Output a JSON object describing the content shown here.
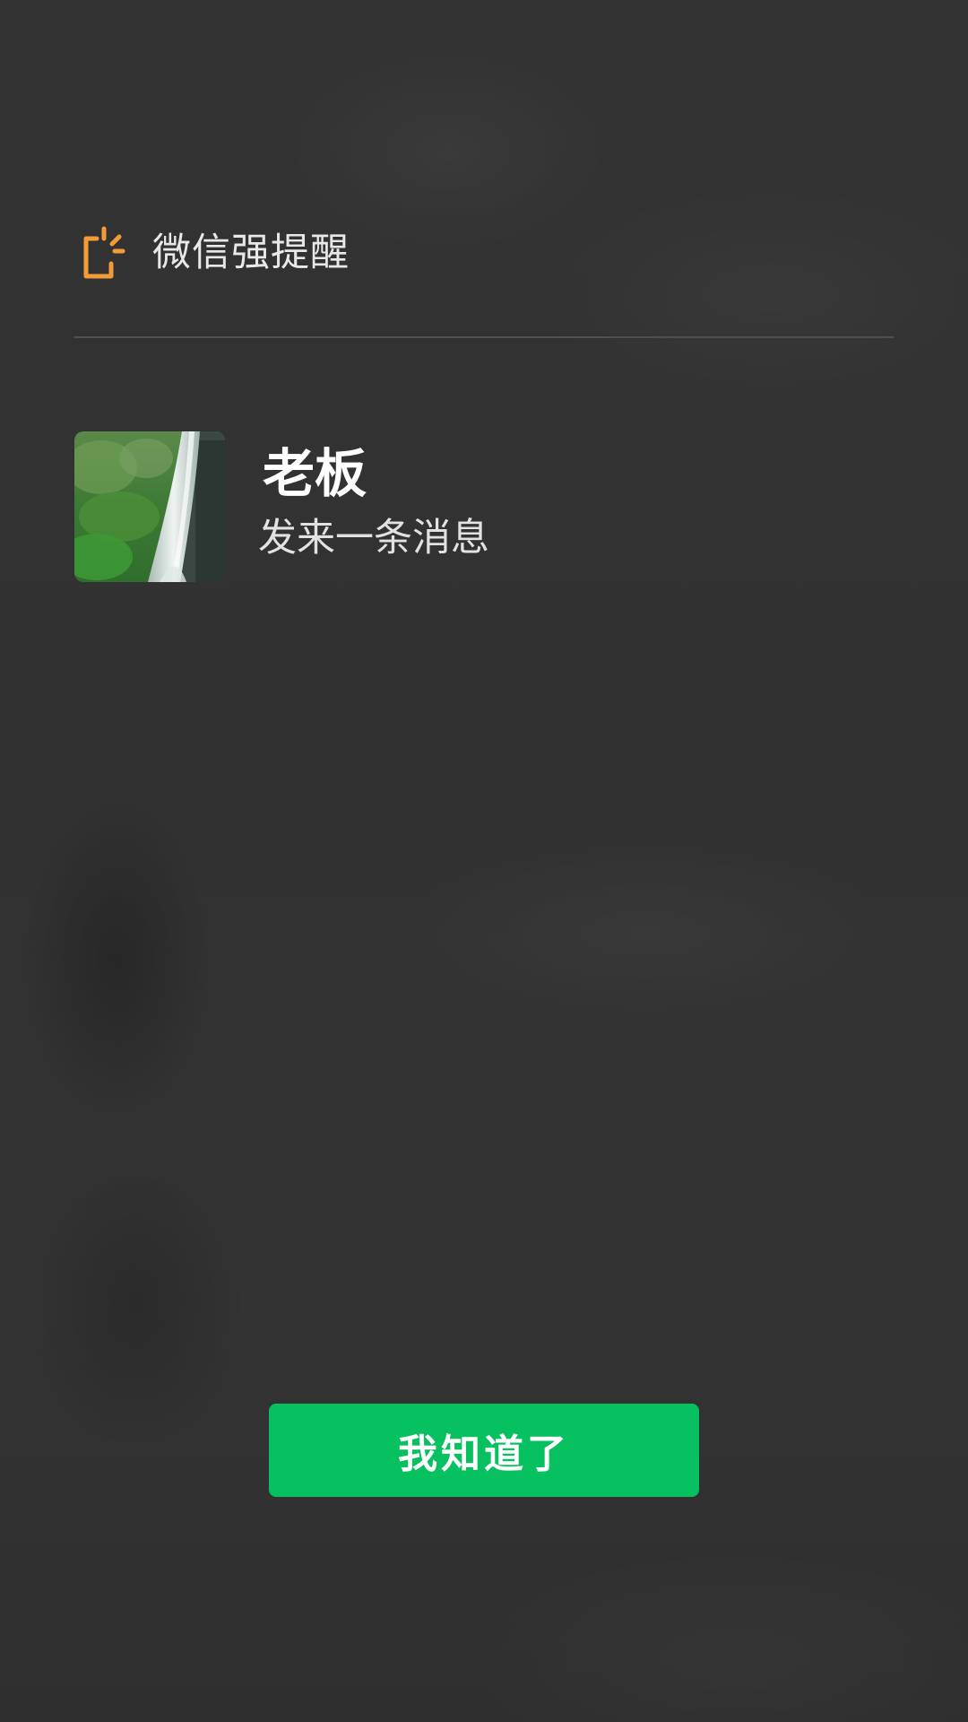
{
  "header": {
    "title": "微信强提醒",
    "icon": "phone-alert-icon",
    "icon_color": "#f29c38"
  },
  "message": {
    "sender_name": "老板",
    "subtitle": "发来一条消息",
    "avatar_icon": "waterfall-avatar-image"
  },
  "actions": {
    "acknowledge_label": "我知道了",
    "button_color": "#07c160"
  }
}
